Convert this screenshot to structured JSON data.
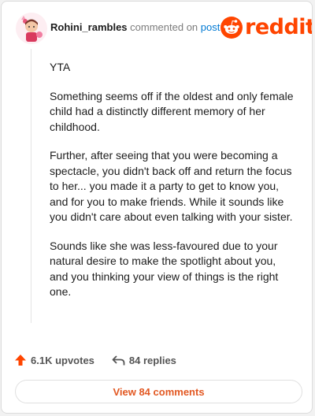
{
  "header": {
    "username": "Rohini_rambles",
    "commented_on": "commented on",
    "post_link": "post",
    "brand": "reddit",
    "brand_color": "#ff4500"
  },
  "comment": {
    "paragraphs": [
      "YTA",
      "Something seems off if the oldest and only female child had a distinctly different memory of her childhood.",
      "Further, after seeing that you were becoming a spectacle, you didn't back off and return the focus to her... you made it a party to get to know you, and for you to make friends. While it sounds like you didn't care about even talking with your sister.",
      "Sounds like she was less-favoured due to your natural desire to make the spotlight about you, and you thinking your view of things is the right one."
    ]
  },
  "footer": {
    "upvotes": "6.1K upvotes",
    "replies": "84 replies",
    "view_comments": "View 84 comments",
    "upvote_icon": "arrow-up-icon",
    "reply_icon": "reply-arrow-icon"
  }
}
